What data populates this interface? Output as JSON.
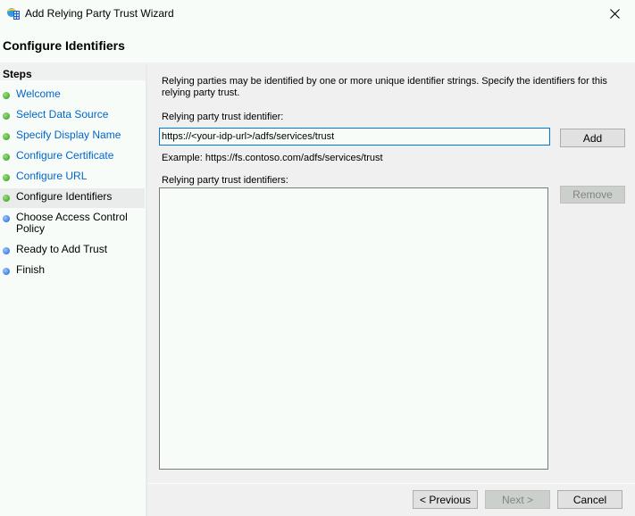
{
  "window": {
    "title": "Add Relying Party Trust Wizard",
    "icon": "adfs-wizard-icon",
    "close_icon": "close-icon"
  },
  "page": {
    "title": "Configure Identifiers"
  },
  "sidebar": {
    "heading": "Steps",
    "items": [
      {
        "label": "Welcome",
        "status": "complete",
        "link": true
      },
      {
        "label": "Select Data Source",
        "status": "complete",
        "link": true
      },
      {
        "label": "Specify Display Name",
        "status": "complete",
        "link": true
      },
      {
        "label": "Configure Certificate",
        "status": "complete",
        "link": true
      },
      {
        "label": "Configure URL",
        "status": "complete",
        "link": true
      },
      {
        "label": "Configure Identifiers",
        "status": "current",
        "link": false
      },
      {
        "label": "Choose Access Control Policy",
        "status": "pending",
        "link": false
      },
      {
        "label": "Ready to Add Trust",
        "status": "pending",
        "link": false
      },
      {
        "label": "Finish",
        "status": "pending",
        "link": false
      }
    ]
  },
  "main": {
    "description": "Relying parties may be identified by one or more unique identifier strings. Specify the identifiers for this relying party trust.",
    "identifier_label": "Relying party trust identifier:",
    "identifier_value": "https://<your-idp-url>/adfs/services/trust",
    "add_label": "Add",
    "example": "Example: https://fs.contoso.com/adfs/services/trust",
    "identifiers_label": "Relying party trust identifiers:",
    "identifiers": [],
    "remove_label": "Remove"
  },
  "footer": {
    "previous_label": "< Previous",
    "next_label": "Next >",
    "cancel_label": "Cancel"
  },
  "colors": {
    "link": "#0066cc",
    "focus_border": "#0078d7",
    "step_complete": "#2c9a1e",
    "step_pending": "#1d5fd8"
  }
}
